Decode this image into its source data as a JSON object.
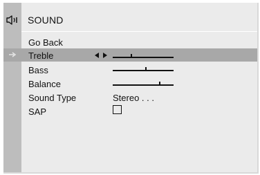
{
  "menu": {
    "title": "SOUND",
    "items": [
      {
        "label": "Go Back"
      },
      {
        "label": "Treble",
        "level": 0.3,
        "selected": true
      },
      {
        "label": "Bass",
        "level": 0.55
      },
      {
        "label": "Balance",
        "level": 0.78
      },
      {
        "label": "Sound Type",
        "value": "Stereo . . ."
      },
      {
        "label": "SAP",
        "checked": false
      }
    ]
  },
  "icons": {
    "header": "speaker-icon",
    "selection": "selection-arrow-icon",
    "adjust": "left-right-arrows-icon"
  },
  "colors": {
    "background": "#ebebeb",
    "sidebar": "#bdbdbd",
    "highlight": "#a8a8a8",
    "text": "#111111"
  }
}
